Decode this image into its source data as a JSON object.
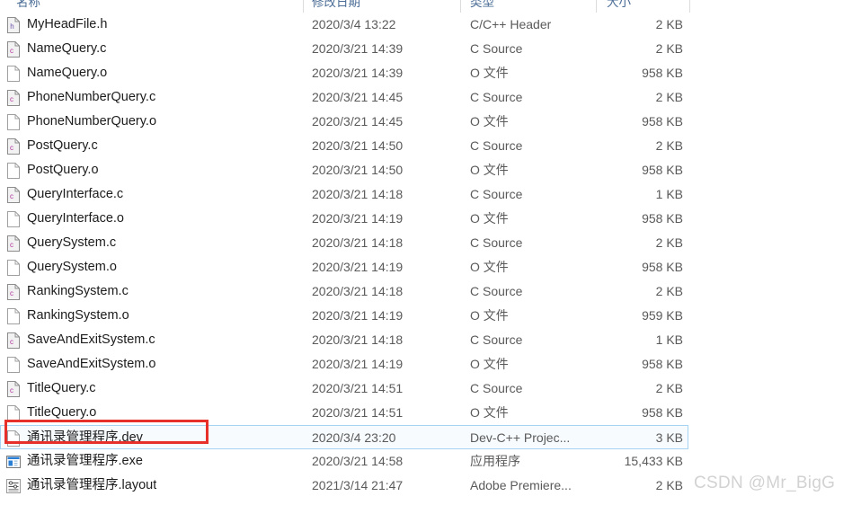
{
  "columns": {
    "name": "名称",
    "date_modified": "修改日期",
    "type": "类型",
    "size": "大小"
  },
  "files": [
    {
      "name": "MyHeadFile.h",
      "date": "2020/3/4 13:22",
      "type": "C/C++ Header",
      "size": "2 KB",
      "icon": "h-source-file-icon",
      "selected": false
    },
    {
      "name": "NameQuery.c",
      "date": "2020/3/21 14:39",
      "type": "C Source",
      "size": "2 KB",
      "icon": "c-source-file-icon",
      "selected": false
    },
    {
      "name": "NameQuery.o",
      "date": "2020/3/21 14:39",
      "type": "O 文件",
      "size": "958 KB",
      "icon": "blank-file-icon",
      "selected": false
    },
    {
      "name": "PhoneNumberQuery.c",
      "date": "2020/3/21 14:45",
      "type": "C Source",
      "size": "2 KB",
      "icon": "c-source-file-icon",
      "selected": false
    },
    {
      "name": "PhoneNumberQuery.o",
      "date": "2020/3/21 14:45",
      "type": "O 文件",
      "size": "958 KB",
      "icon": "blank-file-icon",
      "selected": false
    },
    {
      "name": "PostQuery.c",
      "date": "2020/3/21 14:50",
      "type": "C Source",
      "size": "2 KB",
      "icon": "c-source-file-icon",
      "selected": false
    },
    {
      "name": "PostQuery.o",
      "date": "2020/3/21 14:50",
      "type": "O 文件",
      "size": "958 KB",
      "icon": "blank-file-icon",
      "selected": false
    },
    {
      "name": "QueryInterface.c",
      "date": "2020/3/21 14:18",
      "type": "C Source",
      "size": "1 KB",
      "icon": "c-source-file-icon",
      "selected": false
    },
    {
      "name": "QueryInterface.o",
      "date": "2020/3/21 14:19",
      "type": "O 文件",
      "size": "958 KB",
      "icon": "blank-file-icon",
      "selected": false
    },
    {
      "name": "QuerySystem.c",
      "date": "2020/3/21 14:18",
      "type": "C Source",
      "size": "2 KB",
      "icon": "c-source-file-icon",
      "selected": false
    },
    {
      "name": "QuerySystem.o",
      "date": "2020/3/21 14:19",
      "type": "O 文件",
      "size": "958 KB",
      "icon": "blank-file-icon",
      "selected": false
    },
    {
      "name": "RankingSystem.c",
      "date": "2020/3/21 14:18",
      "type": "C Source",
      "size": "2 KB",
      "icon": "c-source-file-icon",
      "selected": false
    },
    {
      "name": "RankingSystem.o",
      "date": "2020/3/21 14:19",
      "type": "O 文件",
      "size": "959 KB",
      "icon": "blank-file-icon",
      "selected": false
    },
    {
      "name": "SaveAndExitSystem.c",
      "date": "2020/3/21 14:18",
      "type": "C Source",
      "size": "1 KB",
      "icon": "c-source-file-icon",
      "selected": false
    },
    {
      "name": "SaveAndExitSystem.o",
      "date": "2020/3/21 14:19",
      "type": "O 文件",
      "size": "958 KB",
      "icon": "blank-file-icon",
      "selected": false
    },
    {
      "name": "TitleQuery.c",
      "date": "2020/3/21 14:51",
      "type": "C Source",
      "size": "2 KB",
      "icon": "c-source-file-icon",
      "selected": false
    },
    {
      "name": "TitleQuery.o",
      "date": "2020/3/21 14:51",
      "type": "O 文件",
      "size": "958 KB",
      "icon": "blank-file-icon",
      "selected": false
    },
    {
      "name": "通讯录管理程序.dev",
      "date": "2020/3/4 23:20",
      "type": "Dev-C++ Projec...",
      "size": "3 KB",
      "icon": "blank-file-icon",
      "selected": true
    },
    {
      "name": "通讯录管理程序.exe",
      "date": "2020/3/21 14:58",
      "type": "应用程序",
      "size": "15,433 KB",
      "icon": "application-exe-icon",
      "selected": false
    },
    {
      "name": "通讯录管理程序.layout",
      "date": "2021/3/14 21:47",
      "type": "Adobe Premiere...",
      "size": "2 KB",
      "icon": "layout-settings-icon",
      "selected": false
    }
  ],
  "annotation": {
    "highlight_color": "#e8302a",
    "target_row_name": "通讯录管理程序.dev"
  },
  "watermark": {
    "text": "CSDN @Mr_BigG"
  },
  "colors": {
    "header_text": "#4a6c96",
    "row_text": "#1c1c1c",
    "meta_text": "#5a5a5a",
    "selection_border": "#a6d3f2",
    "selection_fill": "#f7fbfe"
  }
}
